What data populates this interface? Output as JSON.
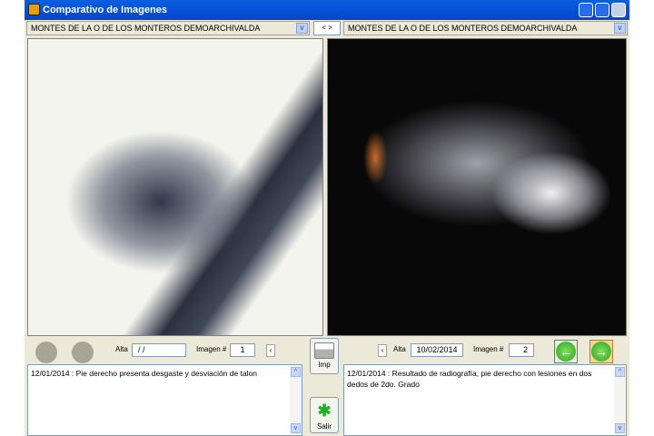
{
  "window": {
    "title": "Comparativo de Imagenes"
  },
  "left": {
    "patient": "MONTES DE LA O DE LOS MONTEROS DEMOARCHIVALDA",
    "alta_label": "Alta",
    "alta_value": " / /",
    "imagen_label": "Imagen #",
    "imagen_value": "1",
    "prev": "‹",
    "notes": "12/01/2014 : Pie derecho presenta desgaste y desviación de talon"
  },
  "right": {
    "patient": "MONTES DE LA O DE LOS MONTEROS DEMOARCHIVALDA",
    "alta_label": "Alta",
    "alta_value": "10/02/2014",
    "imagen_label": "Imagen #",
    "imagen_value": "2",
    "prev": "‹",
    "notes": "12/01/2014 : Resultado de radiografía, pie derecho con lesiones en dos dedos de 2do. Grado"
  },
  "swap_label": "< >",
  "buttons": {
    "print": "Imp",
    "exit": "Salir"
  }
}
